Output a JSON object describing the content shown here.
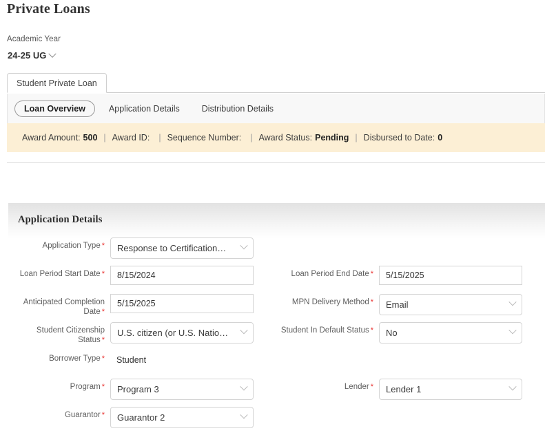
{
  "page": {
    "title": "Private Loans"
  },
  "academic_year": {
    "label": "Academic Year",
    "value": "24-25 UG"
  },
  "tabs": {
    "main": [
      {
        "label": "Student Private Loan",
        "active": true
      }
    ],
    "sub": [
      {
        "label": "Loan Overview",
        "selected": true
      },
      {
        "label": "Application Details",
        "selected": false
      },
      {
        "label": "Distribution Details",
        "selected": false
      }
    ]
  },
  "banner": {
    "background": "#fcefd5",
    "items": [
      {
        "label": "Award Amount:",
        "value": "500"
      },
      {
        "label": "Award ID:",
        "value": ""
      },
      {
        "label": "Sequence Number:",
        "value": ""
      },
      {
        "label": "Award Status:",
        "value": "Pending"
      },
      {
        "label": "Disbursed to Date:",
        "value": "0"
      }
    ],
    "separator": "|"
  },
  "section": {
    "title": "Application Details",
    "rows": [
      {
        "left": {
          "label": "Application Type",
          "required": true,
          "type": "select",
          "value": "Response to Certification…"
        },
        "right": null
      },
      {
        "left": {
          "label": "Loan Period Start Date",
          "required": true,
          "type": "input",
          "value": "8/15/2024"
        },
        "right": {
          "label": "Loan Period End Date",
          "required": true,
          "type": "input",
          "value": "5/15/2025"
        }
      },
      {
        "left": {
          "label": "Anticipated Completion Date",
          "required": true,
          "type": "input",
          "value": "5/15/2025"
        },
        "right": {
          "label": "MPN Delivery Method",
          "required": true,
          "type": "select",
          "value": "Email"
        }
      },
      {
        "left": {
          "label": "Student Citizenship Status",
          "required": true,
          "type": "select",
          "value": "U.S. citizen (or U.S. Natio…"
        },
        "right": {
          "label": "Student In Default Status",
          "required": true,
          "type": "select",
          "value": "No"
        }
      },
      {
        "left": {
          "label": "Borrower Type",
          "required": true,
          "type": "readonly",
          "value": "Student"
        },
        "right": null
      },
      {
        "left": {
          "label": "Program",
          "required": true,
          "type": "select",
          "value": "Program 3"
        },
        "right": {
          "label": "Lender",
          "required": true,
          "type": "select",
          "value": "Lender 1"
        }
      },
      {
        "left": {
          "label": "Guarantor",
          "required": true,
          "type": "select",
          "value": "Guarantor 2"
        },
        "right": null
      }
    ]
  },
  "colors": {
    "banner_bg": "#fcefd5",
    "required_asterisk": "#e8312f",
    "subtab_bg": "#f8f8f8",
    "border": "#d4d4d4"
  }
}
